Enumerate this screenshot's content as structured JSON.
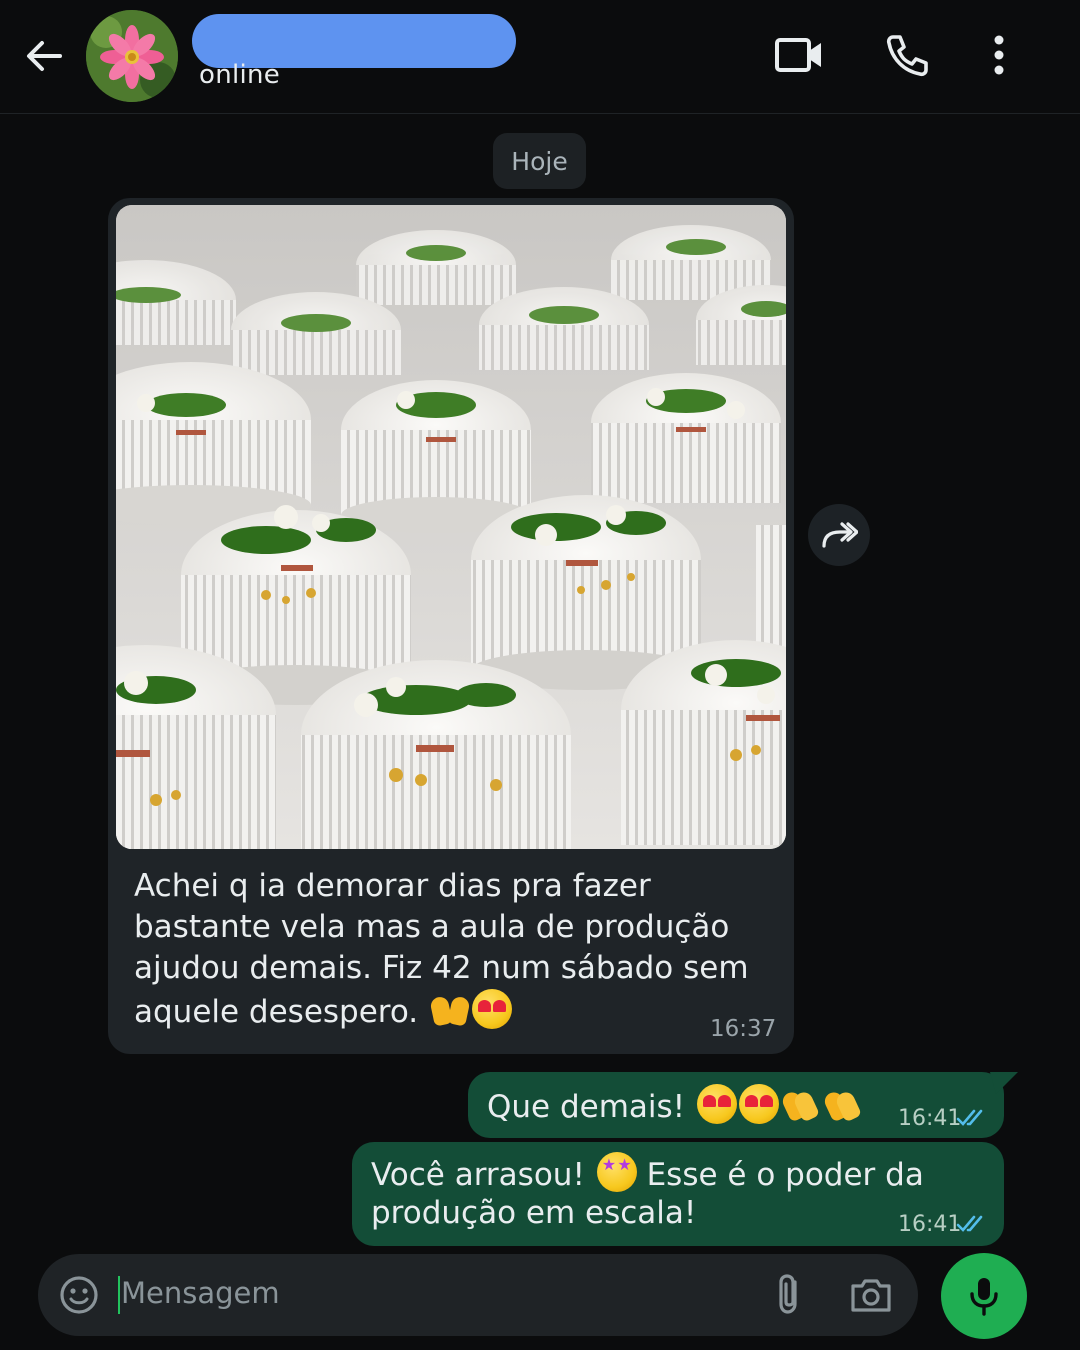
{
  "header": {
    "status": "online",
    "icons": [
      "back-arrow-icon",
      "video-call-icon",
      "phone-icon",
      "more-options-icon"
    ]
  },
  "chat": {
    "date_chip": "Hoje",
    "incoming": {
      "text_lines": [
        "Achei q ia demorar dias pra fazer",
        "bastante vela mas a aula de produção",
        "ajudou demais. Fiz 42 num sábado sem",
        "aquele desespero."
      ],
      "emojis": [
        "raising-hands-emoji",
        "heart-eyes-emoji"
      ],
      "time": "16:37",
      "has_photo": true
    },
    "outgoing": [
      {
        "text": "Que demais!",
        "emojis": [
          "heart-eyes-emoji",
          "heart-eyes-emoji",
          "clapping-hands-emoji",
          "clapping-hands-emoji"
        ],
        "time": "16:41",
        "status": "read"
      },
      {
        "text_line1_before": "Você arrasou!",
        "emoji": "star-struck-emoji",
        "text_line1_after": "Esse é o poder da",
        "text_line2": "produção em escala!",
        "time": "16:41",
        "status": "read"
      }
    ]
  },
  "composer": {
    "placeholder": "Mensagem"
  },
  "colors": {
    "background": "#0b0c0d",
    "incoming_bubble": "#1f2428",
    "outgoing_bubble": "#134d37",
    "read_ticks": "#53bdeb",
    "mic_button": "#1fae52",
    "name_redaction": "#5e93f0"
  }
}
